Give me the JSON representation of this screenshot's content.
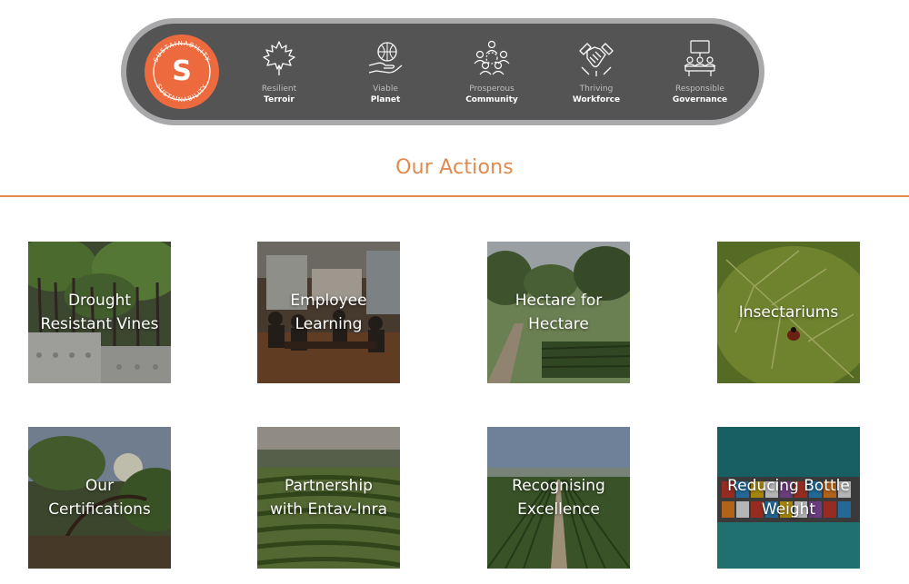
{
  "banner": {
    "badge_letter": "S",
    "badge_ring_text": "SUSTAINABILITY",
    "pillars": [
      {
        "top": "Resilient",
        "main": "Terroir",
        "icon": "maple-leaf-icon"
      },
      {
        "top": "Viable",
        "main": "Planet",
        "icon": "hand-globe-puzzle-icon"
      },
      {
        "top": "Prosperous",
        "main": "Community",
        "icon": "community-people-icon"
      },
      {
        "top": "Thriving",
        "main": "Workforce",
        "icon": "handshake-icon"
      },
      {
        "top": "Responsible",
        "main": "Governance",
        "icon": "boardroom-meeting-icon"
      }
    ]
  },
  "section": {
    "title": "Our Actions"
  },
  "tiles": [
    {
      "label": "Drought Resistant Vines"
    },
    {
      "label": "Employee Learning"
    },
    {
      "label": "Hectare for Hectare"
    },
    {
      "label": "Insectariums"
    },
    {
      "label": "Our Certifications"
    },
    {
      "label": "Partnership with Entav-Inra"
    },
    {
      "label": "Recognising Excellence"
    },
    {
      "label": "Reducing Bottle Weight"
    }
  ],
  "colors": {
    "accent": "#e08a4e",
    "badge": "#ec6a3d",
    "banner_bg": "#545454",
    "banner_border": "#a9a9ab"
  }
}
